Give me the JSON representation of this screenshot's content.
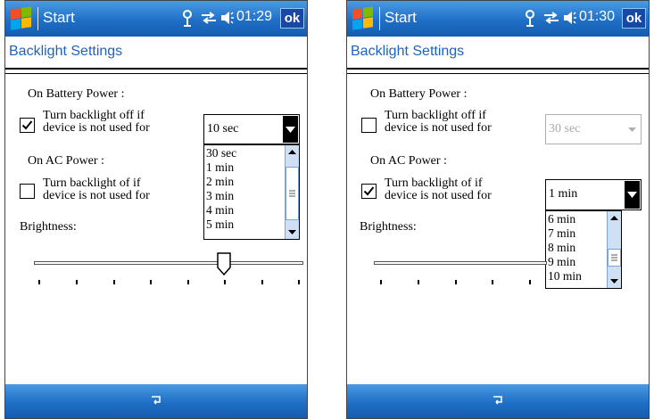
{
  "colors": {
    "bar_blue": "#1f6fc6",
    "title_text": "#1d63c0",
    "scrollbar": "#cfe0f5",
    "selected_bg": "#000000"
  },
  "screens": [
    {
      "start_label": "Start",
      "tray": {
        "signal_icon": "signal-icon",
        "sync_icon": "sync-icon",
        "volume_icon": "speaker-icon",
        "time": "01:29"
      },
      "ok_label": "ok",
      "title": "Backlight Settings",
      "battery_heading": "On Battery Power :",
      "battery_text_1": "Turn backlight off if",
      "battery_text_2": "device is not used for",
      "battery_checked": true,
      "battery_value": "10 sec",
      "ac_heading": "On AC Power :",
      "ac_text_1": "Turn backlight of if",
      "ac_text_2": "device is not used for",
      "ac_checked": false,
      "dropdown_items": [
        "30 sec",
        "1 min",
        "2 min",
        "3 min",
        "4 min",
        "5 min"
      ],
      "brightness_label": "Brightness:",
      "brightness_level_of_8": 6,
      "keyboard_icon": "keyboard-icon"
    },
    {
      "start_label": "Start",
      "tray": {
        "signal_icon": "signal-icon",
        "sync_icon": "sync-icon",
        "volume_icon": "speaker-icon",
        "time": "01:30"
      },
      "ok_label": "ok",
      "title": "Backlight Settings",
      "battery_heading": "On Battery Power :",
      "battery_text_1": "Turn backlight off if",
      "battery_text_2": "device is not used for",
      "battery_checked": false,
      "battery_value": "30 sec",
      "ac_heading": "On AC Power :",
      "ac_text_1": "Turn backlight of if",
      "ac_text_2": "device is not used for",
      "ac_checked": true,
      "ac_value": "1 min",
      "dropdown_items": [
        "6 min",
        "7 min",
        "8 min",
        "9 min",
        "10 min"
      ],
      "brightness_label": "Brightness:",
      "keyboard_icon": "keyboard-icon"
    }
  ]
}
